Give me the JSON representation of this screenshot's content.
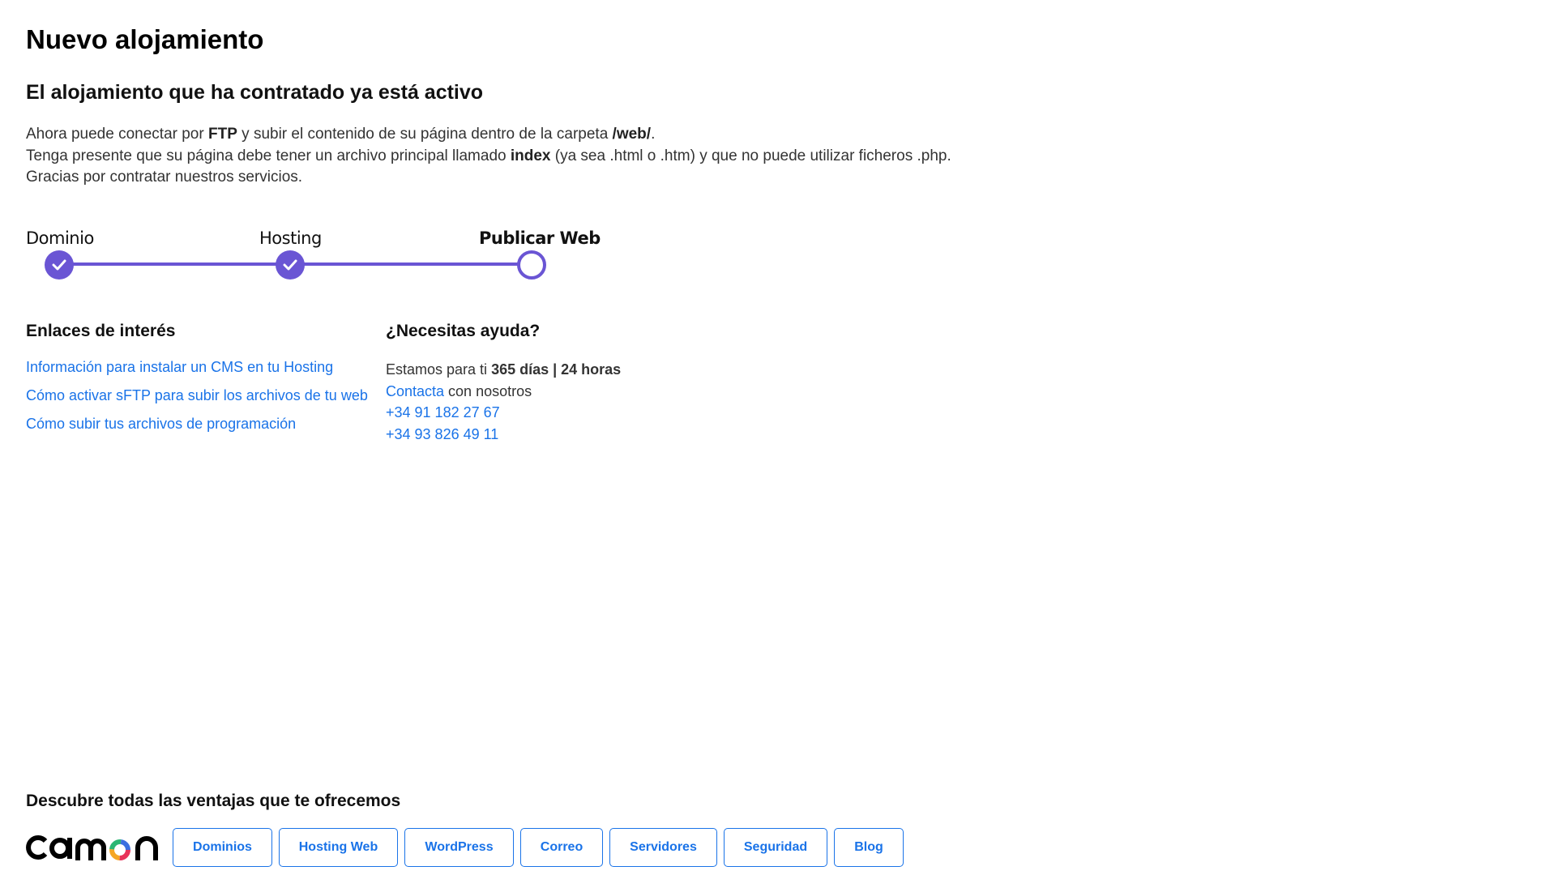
{
  "page_title": "Nuevo alojamiento",
  "subtitle": "El alojamiento que ha contratado ya está activo",
  "intro": {
    "l1_a": "Ahora puede conectar por ",
    "l1_b": "FTP",
    "l1_c": " y subir el contenido de su página dentro de la carpeta ",
    "l1_d": "/web/",
    "l1_e": ".",
    "l2_a": "Tenga presente que su página debe tener un archivo principal llamado ",
    "l2_b": "index",
    "l2_c": " (ya sea .html o .htm) y que no puede utilizar ficheros .php.",
    "l3": "Gracias por contratar nuestros servicios."
  },
  "steps": [
    {
      "label": "Dominio",
      "status": "done"
    },
    {
      "label": "Hosting",
      "status": "done"
    },
    {
      "label": "Publicar Web",
      "status": "current"
    }
  ],
  "links_section": {
    "title": "Enlaces de interés",
    "items": [
      "Información para instalar un CMS en tu Hosting",
      "Cómo activar sFTP para subir los archivos de tu web",
      "Cómo subir tus archivos de programación"
    ]
  },
  "help_section": {
    "title": "¿Necesitas ayuda?",
    "avail_a": "Estamos para ti ",
    "avail_b": "365 días | 24 horas",
    "contact_link": "Contacta",
    "contact_rest": " con nosotros",
    "phones": [
      "+34 91 182 27 67",
      "+34 93 826 49 11"
    ]
  },
  "footer": {
    "title": "Descubre todas las ventajas que te ofrecemos",
    "logo": "cdmon",
    "buttons": [
      "Dominios",
      "Hosting Web",
      "WordPress",
      "Correo",
      "Servidores",
      "Seguridad",
      "Blog"
    ]
  },
  "colors": {
    "accent": "#6a55d4",
    "link": "#1a73e8"
  }
}
